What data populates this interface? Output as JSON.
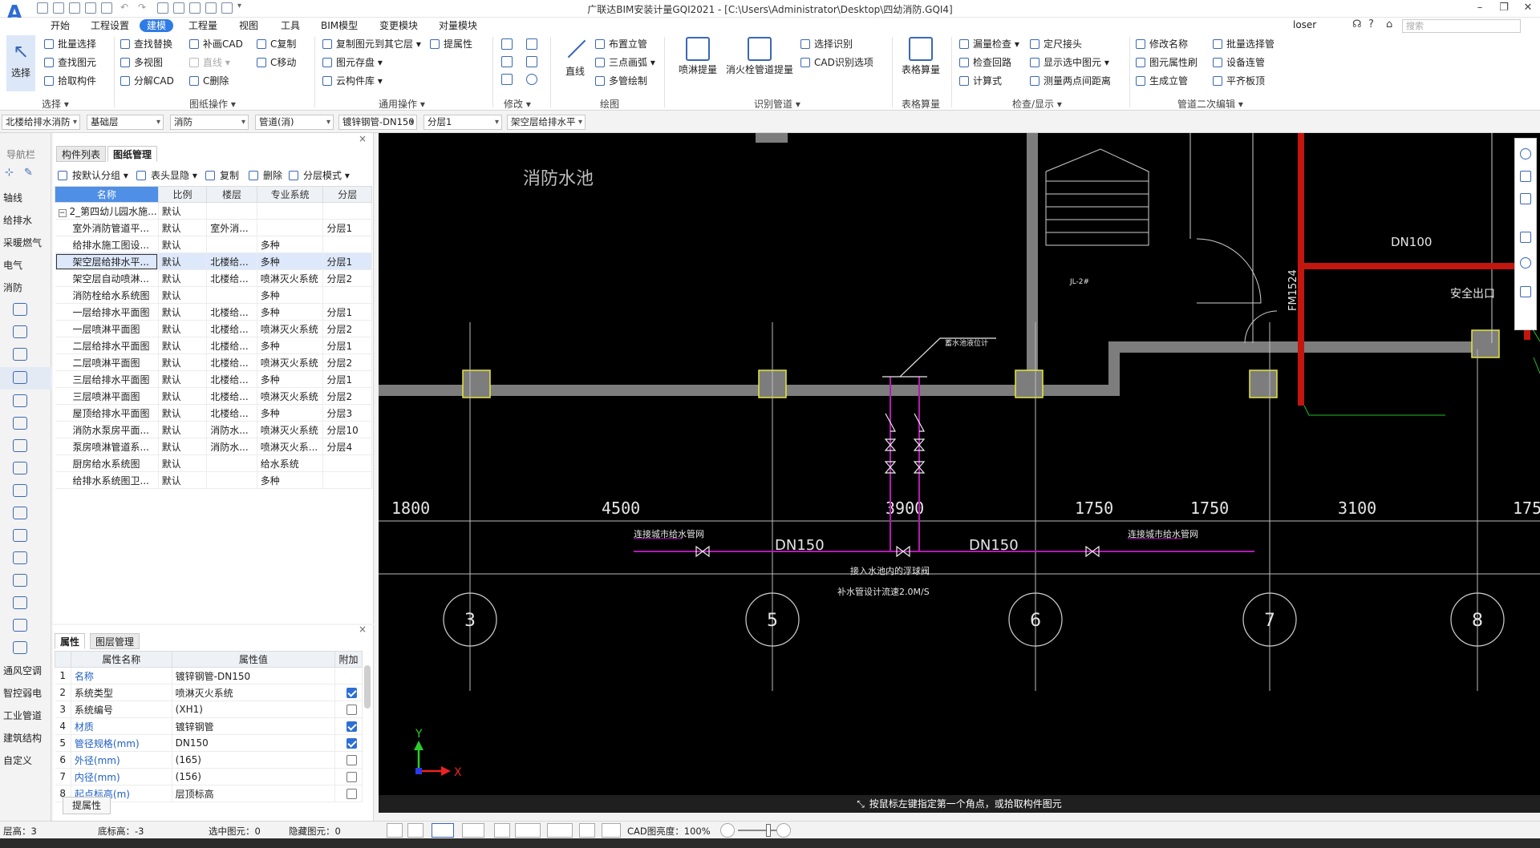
{
  "titlebar": {
    "title": "广联达BIM安装计量GQI2021 - [C:\\Users\\Administrator\\Desktop\\四幼消防.GQI4]",
    "user": "loser",
    "search_placeholder": "搜索",
    "minimize": "–",
    "restore": "❐",
    "close": "✕"
  },
  "menu": {
    "items": [
      "开始",
      "工程设置",
      "建模",
      "工程量",
      "视图",
      "工具",
      "BIM模型",
      "变更模块",
      "对量模块"
    ],
    "active": "建模"
  },
  "ribbon": {
    "select_group": {
      "big_label": "选择",
      "items": [
        "批量选择",
        "查找图元",
        "拾取构件"
      ],
      "group_label": "选择"
    },
    "drawing_ops": {
      "items": [
        "查找替换",
        "多视图",
        "分解CAD",
        "补画CAD",
        "直线",
        "C删除",
        "C复制",
        "C移动"
      ],
      "group_label": "图纸操作"
    },
    "common_ops": {
      "items": [
        "复制图元到其它层",
        "图元存盘",
        "云构件库",
        "提属性"
      ],
      "group_label": "通用操作"
    },
    "modify": {
      "group_label": "修改"
    },
    "draw": {
      "big_label": "直线",
      "items": [
        "布置立管",
        "三点画弧",
        "多管绘制"
      ],
      "group_label": "绘图"
    },
    "recognize": {
      "big_items": [
        "喷淋提量",
        "消火栓管道提量"
      ],
      "items": [
        "选择识别",
        "CAD识别选项"
      ],
      "group_label": "识别管道"
    },
    "table_calc": {
      "big_label": "表格算量",
      "group_label": "表格算量"
    },
    "check": {
      "items": [
        "漏量检查",
        "定尺接头",
        "检查回路",
        "显示选中图元",
        "计算式",
        "测量两点间距离"
      ],
      "group_label": "检查/显示"
    },
    "pipe_edit": {
      "items": [
        "修改名称",
        "批量选择管",
        "图元属性刷",
        "设备连管",
        "生成立管",
        "平齐板顶"
      ],
      "group_label": "管道二次编辑"
    }
  },
  "selectors": [
    "北楼给排水消防",
    "基础层",
    "消防",
    "管道(消)",
    "镀锌钢管-DN150",
    "分层1",
    "架空层给排水平"
  ],
  "nav": {
    "title": "导航栏",
    "items": [
      "轴线",
      "给排水",
      "采暖燃气",
      "电气",
      "消防"
    ],
    "bottom_items": [
      "通风空调",
      "智控弱电",
      "工业管道",
      "建筑结构",
      "自定义"
    ]
  },
  "drawing_panel": {
    "tabs": [
      "构件列表",
      "图纸管理"
    ],
    "active_tab": "图纸管理",
    "tools": [
      "按默认分组",
      "表头显隐",
      "复制",
      "删除",
      "分层模式"
    ],
    "columns": [
      "名称",
      "比例",
      "楼层",
      "专业系统",
      "分层"
    ],
    "group_row": {
      "name": "2_第四幼儿园水施...",
      "scale": "默认",
      "expander": "−"
    },
    "rows": [
      {
        "name": "室外消防管道平...",
        "scale": "默认",
        "floor": "室外消...",
        "system": "",
        "layer": "分层1"
      },
      {
        "name": "给排水施工图设...",
        "scale": "默认",
        "floor": "",
        "system": "多种",
        "layer": ""
      },
      {
        "name": "架空层给排水平...",
        "scale": "默认",
        "floor": "北楼给...",
        "system": "多种",
        "layer": "分层1"
      },
      {
        "name": "架空层自动喷淋...",
        "scale": "默认",
        "floor": "北楼给...",
        "system": "喷淋灭火系统",
        "layer": "分层2"
      },
      {
        "name": "消防栓给水系统图",
        "scale": "默认",
        "floor": "",
        "system": "多种",
        "layer": ""
      },
      {
        "name": "一层给排水平面图",
        "scale": "默认",
        "floor": "北楼给...",
        "system": "多种",
        "layer": "分层1"
      },
      {
        "name": "一层喷淋平面图",
        "scale": "默认",
        "floor": "北楼给...",
        "system": "喷淋灭火系统",
        "layer": "分层2"
      },
      {
        "name": "二层给排水平面图",
        "scale": "默认",
        "floor": "北楼给...",
        "system": "多种",
        "layer": "分层1"
      },
      {
        "name": "二层喷淋平面图",
        "scale": "默认",
        "floor": "北楼给...",
        "system": "喷淋灭火系统",
        "layer": "分层2"
      },
      {
        "name": "三层给排水平面图",
        "scale": "默认",
        "floor": "北楼给...",
        "system": "多种",
        "layer": "分层1"
      },
      {
        "name": "三层喷淋平面图",
        "scale": "默认",
        "floor": "北楼给...",
        "system": "喷淋灭火系统",
        "layer": "分层2"
      },
      {
        "name": "屋顶给排水平面图",
        "scale": "默认",
        "floor": "北楼给...",
        "system": "多种",
        "layer": "分层3"
      },
      {
        "name": "消防水泵房平面...",
        "scale": "默认",
        "floor": "消防水...",
        "system": "喷淋灭火系统",
        "layer": "分层10"
      },
      {
        "name": "泵房喷淋管道系...",
        "scale": "默认",
        "floor": "消防水...",
        "system": "喷淋灭火系...",
        "layer": "分层4"
      },
      {
        "name": "厨房给水系统图",
        "scale": "默认",
        "floor": "",
        "system": "给水系统",
        "layer": ""
      },
      {
        "name": "给排水系统图卫...",
        "scale": "默认",
        "floor": "",
        "system": "多种",
        "layer": ""
      }
    ],
    "selected_index": 2
  },
  "properties_panel": {
    "tabs": [
      "属性",
      "图层管理"
    ],
    "active_tab": "属性",
    "columns": [
      "属性名称",
      "属性值",
      "附加"
    ],
    "rows": [
      {
        "idx": "1",
        "name": "名称",
        "value": "镀锌钢管-DN150",
        "checked": null,
        "blue": true
      },
      {
        "idx": "2",
        "name": "系统类型",
        "value": "喷淋灭火系统",
        "checked": true,
        "blue": false
      },
      {
        "idx": "3",
        "name": "系统编号",
        "value": "(XH1)",
        "checked": false,
        "blue": false
      },
      {
        "idx": "4",
        "name": "材质",
        "value": "镀锌钢管",
        "checked": true,
        "blue": true
      },
      {
        "idx": "5",
        "name": "管径规格(mm)",
        "value": "DN150",
        "checked": true,
        "blue": true
      },
      {
        "idx": "6",
        "name": "外径(mm)",
        "value": "(165)",
        "checked": false,
        "blue": true
      },
      {
        "idx": "7",
        "name": "内径(mm)",
        "value": "(156)",
        "checked": false,
        "blue": true
      },
      {
        "idx": "8",
        "name": "起点标高(m)",
        "value": "层顶标高",
        "checked": false,
        "blue": true
      }
    ],
    "footer_button": "提属性"
  },
  "canvas": {
    "room_label": "消防水池",
    "dims": [
      "1800",
      "4500",
      "3900",
      "1750",
      "1750",
      "3100",
      "175"
    ],
    "pipe_labels": [
      "DN150",
      "DN150",
      "DN100"
    ],
    "notes": [
      "连接城市给水管网",
      "连接城市给水管网",
      "接入水池内的浮球阀",
      "补水管设计流速2.0M/S",
      "蓄水池液位计",
      "安全出口",
      "FM1524",
      "JL-2#"
    ],
    "axes": [
      "3",
      "5",
      "6",
      "7",
      "8"
    ],
    "axis_y": "Y",
    "axis_x": "X",
    "prompt": "按鼠标左键指定第一个角点，或拾取构件图元"
  },
  "status": {
    "floor_height": "层高：3",
    "bottom_elev": "底标高：-3",
    "selected": "选中图元：0",
    "hidden": "隐藏图元：0",
    "cad_brightness": "CAD图亮度：100%"
  }
}
